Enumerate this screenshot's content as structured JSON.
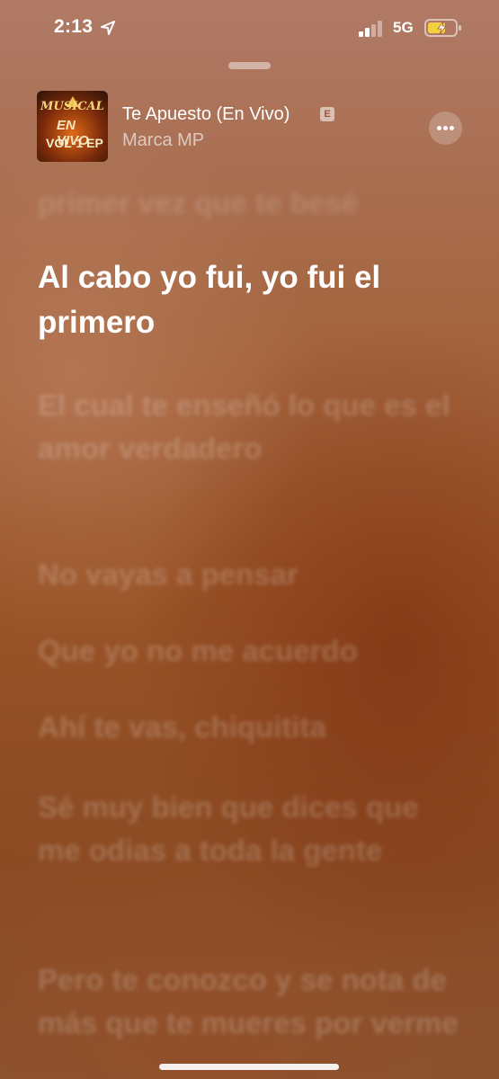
{
  "status_bar": {
    "time": "2:13",
    "network": "5G",
    "icons": [
      "location-arrow-icon",
      "signal-bars-icon",
      "battery-charging-icon"
    ]
  },
  "now_playing": {
    "title": "Te Apuesto (En Vivo)",
    "explicit_badge": "E",
    "artist": "Marca MP",
    "album_art_text": [
      "MUSICAL",
      "EN VIVO",
      "VOL-1 EP"
    ],
    "more_icon": "ellipsis-icon"
  },
  "lyrics": {
    "previous": "primer vez que te besé",
    "active": "Al cabo yo fui, yo fui el primero",
    "upcoming": [
      "El cual te enseñó lo que es el amor verdadero",
      "No vayas a pensar",
      "Que yo no me acuerdo",
      "Ahí te vas, chiquitita",
      "Sé muy bien que dices que me odias a toda la gente",
      "Pero te conozco y se nota de más que te mueres por verme"
    ]
  },
  "colors": {
    "background_top": "#b07a66",
    "background_bottom": "#8b5230",
    "text_active": "#ffffff"
  }
}
